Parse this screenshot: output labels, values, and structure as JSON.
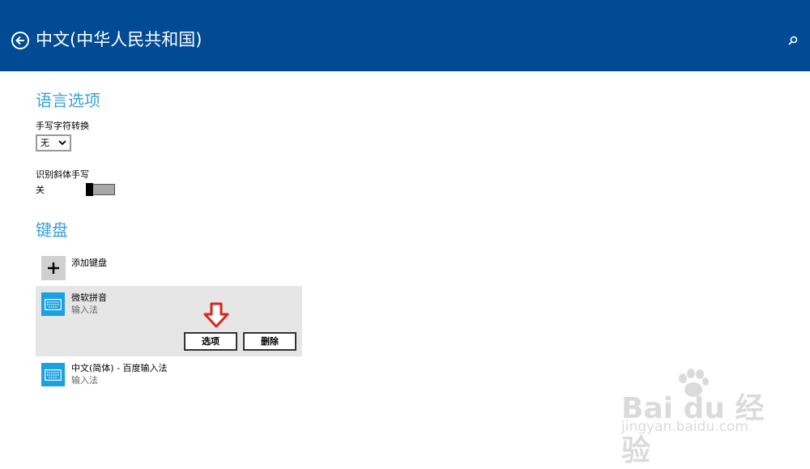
{
  "header": {
    "title": "中文(中华人民共和国)",
    "back_icon": "arrow-left-circle-icon",
    "search_icon": "search-icon",
    "bg_color": "#004b94"
  },
  "language_options": {
    "section_title": "语言选项",
    "handwriting_conversion": {
      "label": "手写字符转换",
      "selected_value": "无"
    },
    "italic_recognition": {
      "label": "识别斜体手写",
      "state_text": "关"
    }
  },
  "keyboards": {
    "section_title": "键盘",
    "add_keyboard_label": "添加键盘",
    "items": [
      {
        "name": "微软拼音",
        "subtitle": "输入法",
        "selected": true
      },
      {
        "name": "中文(简体) - 百度输入法",
        "subtitle": "输入法",
        "selected": false
      }
    ],
    "options_button": "选项",
    "delete_button": "删除"
  },
  "watermark": {
    "line1": "Bai du 经验",
    "line2": "jingyan.baidu.com"
  },
  "colors": {
    "accent": "#3aa0d8",
    "keyboard_icon": "#1aa1e1",
    "annotation_arrow": "#d9261c"
  }
}
